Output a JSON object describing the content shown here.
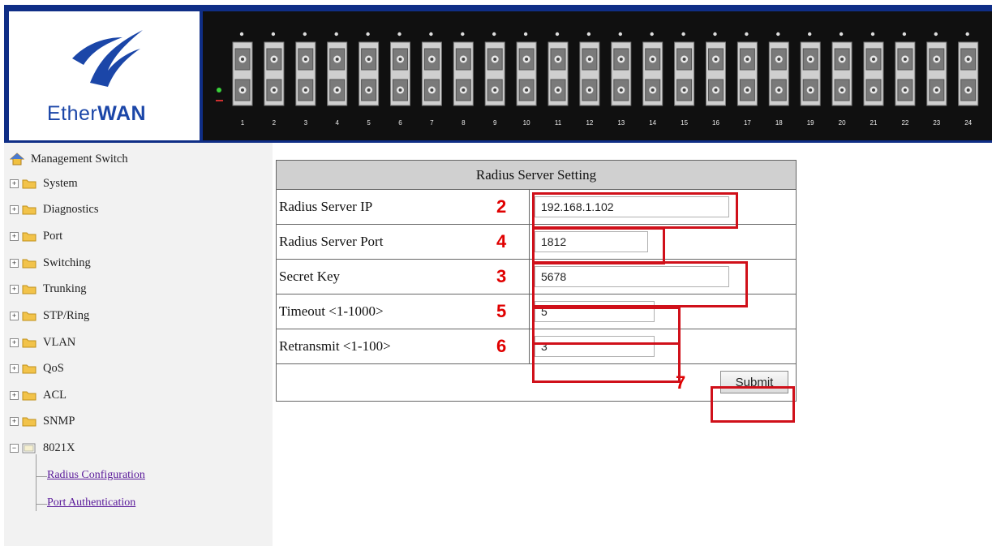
{
  "header": {
    "brand_prefix": "Ether",
    "brand_suffix": "WAN",
    "port_numbers": [
      "1",
      "2",
      "3",
      "4",
      "5",
      "6",
      "7",
      "8",
      "9",
      "10",
      "11",
      "12",
      "13",
      "14",
      "15",
      "16",
      "17",
      "18",
      "19",
      "20",
      "21",
      "22",
      "23",
      "24"
    ]
  },
  "sidebar": {
    "root": "Management Switch",
    "items": [
      {
        "label": "System",
        "expanded": false
      },
      {
        "label": "Diagnostics",
        "expanded": false
      },
      {
        "label": "Port",
        "expanded": false
      },
      {
        "label": "Switching",
        "expanded": false
      },
      {
        "label": "Trunking",
        "expanded": false
      },
      {
        "label": "STP/Ring",
        "expanded": false
      },
      {
        "label": "VLAN",
        "expanded": false
      },
      {
        "label": "QoS",
        "expanded": false
      },
      {
        "label": "ACL",
        "expanded": false
      },
      {
        "label": "SNMP",
        "expanded": false
      },
      {
        "label": "8021X",
        "expanded": true
      }
    ],
    "links": [
      "Radius Configuration",
      "Port Authentication"
    ]
  },
  "form": {
    "title": "Radius Server Setting",
    "rows": [
      {
        "label": "Radius Server IP",
        "marker": "2",
        "value": "192.168.1.102"
      },
      {
        "label": "Radius Server Port",
        "marker": "4",
        "value": "1812"
      },
      {
        "label": "Secret Key",
        "marker": "3",
        "value": "5678"
      },
      {
        "label": "Timeout <1-1000>",
        "marker": "5",
        "value": "5"
      },
      {
        "label": "Retransmit <1-100>",
        "marker": "6",
        "value": "3"
      }
    ],
    "submit_marker": "7",
    "submit_label": "Submit"
  },
  "colors": {
    "header_bg": "#0f2e86",
    "port_panel_bg": "#101010",
    "annotation_red": "#d0101a",
    "table_title_bg": "#d0d0d0",
    "link_color": "#5a1a9a"
  }
}
